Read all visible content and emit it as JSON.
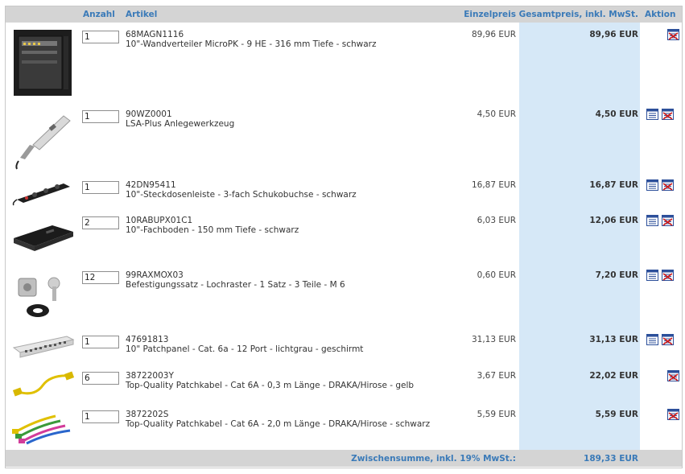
{
  "header": {
    "anzahl": "Anzahl",
    "artikel": "Artikel",
    "einzelpreis": "Einzelpreis",
    "gesamtpreis": "Gesamtpreis, inkl. MwSt.",
    "aktion": "Aktion"
  },
  "items": [
    {
      "qty": "1",
      "sku": "68MAGN1116",
      "name": "10\"-Wandverteiler MicroPK - 9 HE - 316 mm Tiefe - schwarz",
      "unit_price": "89,96 EUR",
      "total": "89,96 EUR",
      "image": "wall-cabinet",
      "actions": [
        "delete-icon"
      ]
    },
    {
      "qty": "1",
      "sku": "90WZ0001",
      "name": "LSA-Plus Anlegewerkzeug",
      "unit_price": "4,50 EUR",
      "total": "4,50 EUR",
      "image": "lsa-tool",
      "actions": [
        "edit-icon",
        "delete-icon"
      ]
    },
    {
      "qty": "1",
      "sku": "42DN95411",
      "name": "10\"-Steckdosenleiste - 3-fach Schukobuchse - schwarz",
      "unit_price": "16,87 EUR",
      "total": "16,87 EUR",
      "image": "power-strip",
      "actions": [
        "edit-icon",
        "delete-icon"
      ]
    },
    {
      "qty": "2",
      "sku": "10RABUPX01C1",
      "name": "10\"-Fachboden - 150 mm Tiefe - schwarz",
      "unit_price": "6,03 EUR",
      "total": "12,06 EUR",
      "image": "shelf",
      "actions": [
        "edit-icon",
        "delete-icon"
      ]
    },
    {
      "qty": "12",
      "sku": "99RAXMOX03",
      "name": "Befestigungssatz - Lochraster - 1 Satz - 3 Teile - M 6",
      "unit_price": "0,60 EUR",
      "total": "7,20 EUR",
      "image": "mounting-kit",
      "actions": [
        "edit-icon",
        "delete-icon"
      ]
    },
    {
      "qty": "1",
      "sku": "47691813",
      "name": "10\" Patchpanel - Cat. 6a - 12 Port - lichtgrau - geschirmt",
      "unit_price": "31,13 EUR",
      "total": "31,13 EUR",
      "image": "patch-panel",
      "actions": [
        "edit-icon",
        "delete-icon"
      ]
    },
    {
      "qty": "6",
      "sku": "38722003Y",
      "name": "Top-Quality Patchkabel - Cat 6A - 0,3 m Länge - DRAKA/Hirose - gelb",
      "unit_price": "3,67 EUR",
      "total": "22,02 EUR",
      "image": "cable-yellow",
      "actions": [
        "delete-icon"
      ]
    },
    {
      "qty": "1",
      "sku": "3872202S",
      "name": "Top-Quality Patchkabel - Cat 6A - 2,0 m Länge - DRAKA/Hirose - schwarz",
      "unit_price": "5,59 EUR",
      "total": "5,59 EUR",
      "image": "cable-multi",
      "actions": [
        "delete-icon"
      ]
    }
  ],
  "footer": {
    "subtotal_label": "Zwischensumme, inkl. 19% MwSt.:",
    "subtotal_value": "189,33 EUR"
  },
  "colors": {
    "accent": "#3a7ab8",
    "header_bg": "#d4d4d4",
    "total_column_bg": "#d6e8f7"
  }
}
